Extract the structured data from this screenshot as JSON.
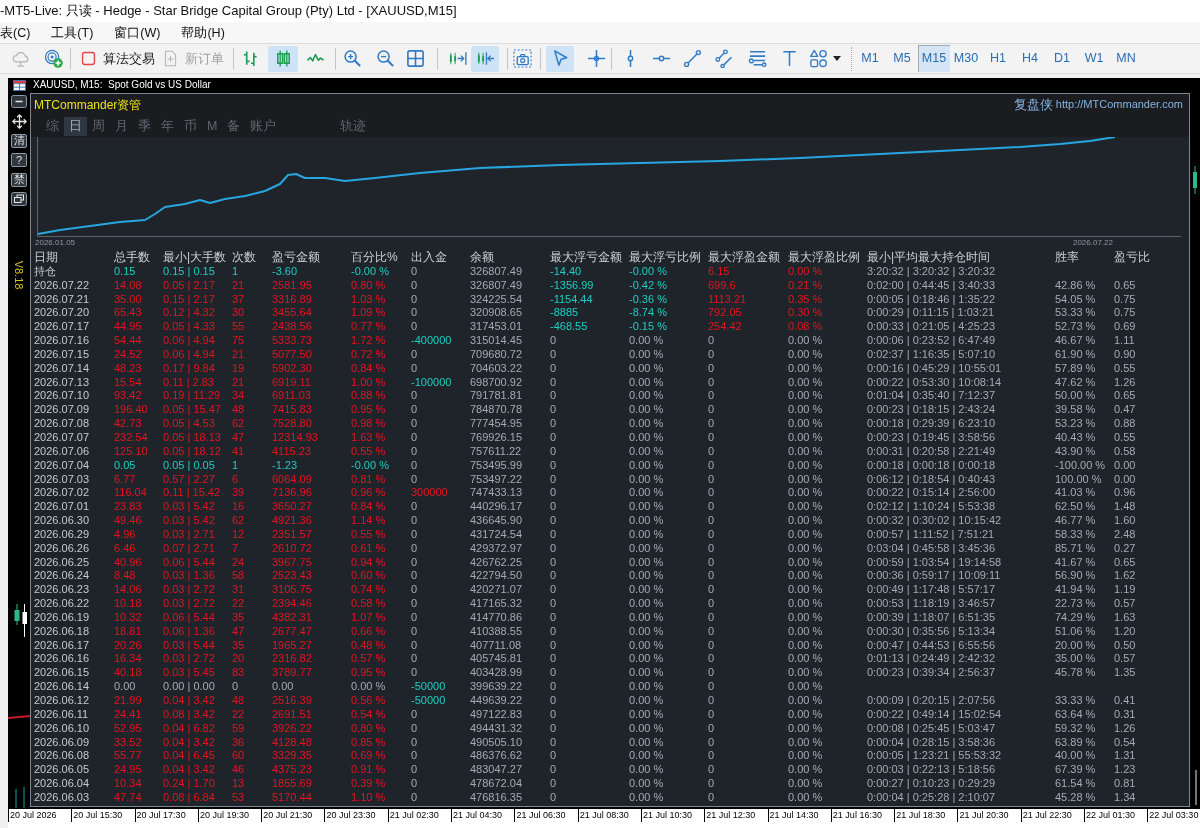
{
  "window": {
    "title": "-MT5-Live: 只读 - Hedge - Star Bridge Capital Group (Pty) Ltd - [XAUUSD,M15]"
  },
  "menu": [
    "表(C)",
    "工具(T)",
    "窗口(W)",
    "帮助(H)"
  ],
  "toolbar": {
    "services": [
      {
        "disabled": true
      },
      {
        "disabled": false
      }
    ],
    "buttons": [
      {
        "label": "算法交易",
        "disabled": false
      },
      {
        "label": "新订单",
        "disabled": true
      }
    ],
    "chart_modes": [
      {
        "selected": false
      },
      {
        "selected": true
      },
      {
        "selected": false
      }
    ],
    "chart_toggles": [
      {
        "on": false
      },
      {
        "on": true
      }
    ],
    "pointer_modes": [
      {
        "selected": true
      },
      {
        "selected": false
      }
    ],
    "timeframes": [
      {
        "label": "M1",
        "selected": false
      },
      {
        "label": "M5",
        "selected": false
      },
      {
        "label": "M15",
        "selected": true
      },
      {
        "label": "M30",
        "selected": false
      },
      {
        "label": "H1",
        "selected": false
      },
      {
        "label": "H4",
        "selected": false
      },
      {
        "label": "D1",
        "selected": false
      },
      {
        "label": "W1",
        "selected": false
      },
      {
        "label": "MN",
        "selected": false
      }
    ]
  },
  "chart": {
    "title": "XAUUSD, M15:  Spot Gold vs US Dollar",
    "side_buttons": [
      "清",
      "?",
      "禁"
    ],
    "version": "V8.18",
    "time_axis": [
      "20 Jul 2026",
      "20 Jul 15:30",
      "20 Jul 17:30",
      "20 Jul 19:30",
      "20 Jul 21:30",
      "20 Jul 23:30",
      "21 Jul 02:30",
      "21 Jul 04:30",
      "21 Jul 06:30",
      "21 Jul 08:30",
      "21 Jul 10:30",
      "21 Jul 12:30",
      "21 Jul 14:30",
      "21 Jul 16:30",
      "21 Jul 18:30",
      "21 Jul 20:30",
      "21 Jul 22:30",
      "22 Jul 01:30",
      "22 Jul 03:30"
    ]
  },
  "panel": {
    "title": "MTCommander资管",
    "brand": "复盘侠",
    "link": "http://MTCommander.com",
    "tabs": [
      {
        "label": "综",
        "selected": false
      },
      {
        "label": "日",
        "selected": true
      },
      {
        "label": "周",
        "selected": false
      },
      {
        "label": "月",
        "selected": false
      },
      {
        "label": "季",
        "selected": false
      },
      {
        "label": "年",
        "selected": false
      },
      {
        "label": "币",
        "selected": false
      },
      {
        "label": "M",
        "selected": false
      },
      {
        "label": "备",
        "selected": false
      },
      {
        "label": "账户",
        "selected": false
      }
    ],
    "extra_tabs": [
      {
        "label": "轨迹",
        "selected": false
      }
    ],
    "equity_curve": {
      "start_label": "2026.01.05",
      "end_label": "2026.07.22"
    },
    "table": {
      "columns": [
        "日期",
        "总手数",
        "最小|大手数",
        "次数",
        "盈亏金额",
        "百分比%",
        "出入金",
        "余额",
        "最大浮亏金额",
        "最大浮亏比例",
        "最大浮盈金额",
        "最大浮盈比例",
        "最小|平均最大持仓时间",
        "胜率",
        "盈亏比"
      ],
      "rows": [
        {
          "kind": "loss",
          "deposit": false,
          "withdrawal": false,
          "floating": true,
          "cells": [
            "持仓",
            "0.15",
            "0.15 | 0.15",
            "1",
            "-3.60",
            "-0.00 %",
            "0",
            "326807.49",
            "-14.40",
            "-0.00 %",
            "6.15",
            "0.00 %",
            "3:20:32 | 3:20:32 | 3:20:32"
          ]
        },
        {
          "kind": "gain",
          "deposit": false,
          "withdrawal": false,
          "floating": true,
          "cells": [
            "2026.07.22",
            "14.08",
            "0.05 | 2.17",
            "21",
            "2581.95",
            "0.80 %",
            "0",
            "326807.49",
            "-1356.99",
            "-0.42 %",
            "699.6",
            "0.21 %",
            "0:02:00 | 0:44:45 | 3:40:33",
            "42.86 %",
            "0.65"
          ]
        },
        {
          "kind": "gain",
          "deposit": false,
          "withdrawal": false,
          "floating": true,
          "cells": [
            "2026.07.21",
            "35.00",
            "0.15 | 2.17",
            "37",
            "3316.89",
            "1.03 %",
            "0",
            "324225.54",
            "-1154.44",
            "-0.36 %",
            "1113.21",
            "0.35 %",
            "0:00:05 | 0:18:46 | 1:35:22",
            "54.05 %",
            "0.75"
          ]
        },
        {
          "kind": "gain",
          "deposit": false,
          "withdrawal": false,
          "floating": true,
          "cells": [
            "2026.07.20",
            "65.43",
            "0.12 | 4.32",
            "30",
            "3455.64",
            "1.09 %",
            "0",
            "320908.65",
            "-8885",
            "-8.74 %",
            "792.05",
            "0.30 %",
            "0:00:29 | 0:11:15 | 1:03:21",
            "53.33 %",
            "0.75"
          ]
        },
        {
          "kind": "gain",
          "deposit": false,
          "withdrawal": false,
          "floating": true,
          "cells": [
            "2026.07.17",
            "44.95",
            "0.05 | 4.33",
            "55",
            "2438.56",
            "0.77 %",
            "0",
            "317453.01",
            "-468.55",
            "-0.15 %",
            "254.42",
            "0.08 %",
            "0:00:33 | 0:21:05 | 4:25:23",
            "52.73 %",
            "0.69"
          ]
        },
        {
          "kind": "gain",
          "deposit": false,
          "withdrawal": true,
          "floating": false,
          "cells": [
            "2026.07.16",
            "54.44",
            "0.06 | 4.94",
            "75",
            "5333.73",
            "1.72 %",
            "-400000",
            "315014.45",
            "0",
            "0.00 %",
            "0",
            "0.00 %",
            "0:00:06 | 0:23:52 | 6:47:49",
            "46.67 %",
            "1.11"
          ]
        },
        {
          "kind": "gain",
          "deposit": false,
          "withdrawal": false,
          "floating": false,
          "cells": [
            "2026.07.15",
            "24.52",
            "0.06 | 4.94",
            "21",
            "5077.50",
            "0.72 %",
            "0",
            "709680.72",
            "0",
            "0.00 %",
            "0",
            "0.00 %",
            "0:02:37 | 1:16:35 | 5:07:10",
            "61.90 %",
            "0.90"
          ]
        },
        {
          "kind": "gain",
          "deposit": false,
          "withdrawal": false,
          "floating": false,
          "cells": [
            "2026.07.14",
            "48.23",
            "0.17 | 9.84",
            "19",
            "5902.30",
            "0.84 %",
            "0",
            "704603.22",
            "0",
            "0.00 %",
            "0",
            "0.00 %",
            "0:00:16 | 0:45:29 | 10:55:01",
            "57.89 %",
            "0.55"
          ]
        },
        {
          "kind": "gain",
          "deposit": false,
          "withdrawal": true,
          "floating": false,
          "cells": [
            "2026.07.13",
            "15.54",
            "0.11 | 2.83",
            "21",
            "6919.11",
            "1.00 %",
            "-100000",
            "698700.92",
            "0",
            "0.00 %",
            "0",
            "0.00 %",
            "0:00:22 | 0:53:30 | 10:08:14",
            "47.62 %",
            "1.26"
          ]
        },
        {
          "kind": "gain",
          "deposit": false,
          "withdrawal": false,
          "floating": false,
          "cells": [
            "2026.07.10",
            "93.42",
            "0.19 | 11.29",
            "34",
            "6911.03",
            "0.88 %",
            "0",
            "791781.81",
            "0",
            "0.00 %",
            "0",
            "0.00 %",
            "0:01:04 | 0:35:40 | 7:12:37",
            "50.00 %",
            "0.65"
          ]
        },
        {
          "kind": "gain",
          "deposit": false,
          "withdrawal": false,
          "floating": false,
          "cells": [
            "2026.07.09",
            "196.40",
            "0.05 | 15.47",
            "48",
            "7415.83",
            "0.95 %",
            "0",
            "784870.78",
            "0",
            "0.00 %",
            "0",
            "0.00 %",
            "0:00:23 | 0:18:15 | 2:43:24",
            "39.58 %",
            "0.47"
          ]
        },
        {
          "kind": "gain",
          "deposit": false,
          "withdrawal": false,
          "floating": false,
          "cells": [
            "2026.07.08",
            "42.73",
            "0.05 | 4.53",
            "62",
            "7528.80",
            "0.98 %",
            "0",
            "777454.95",
            "0",
            "0.00 %",
            "0",
            "0.00 %",
            "0:00:18 | 0:29:39 | 6:23:10",
            "53.23 %",
            "0.88"
          ]
        },
        {
          "kind": "gain",
          "deposit": false,
          "withdrawal": false,
          "floating": false,
          "cells": [
            "2026.07.07",
            "232.54",
            "0.05 | 18.13",
            "47",
            "12314.93",
            "1.63 %",
            "0",
            "769926.15",
            "0",
            "0.00 %",
            "0",
            "0.00 %",
            "0:00:23 | 0:19:45 | 3:58:56",
            "40.43 %",
            "0.55"
          ]
        },
        {
          "kind": "gain",
          "deposit": false,
          "withdrawal": false,
          "floating": false,
          "cells": [
            "2026.07.06",
            "125.10",
            "0.05 | 18.12",
            "41",
            "4115.23",
            "0.55 %",
            "0",
            "757611.22",
            "0",
            "0.00 %",
            "0",
            "0.00 %",
            "0:00:31 | 0:20:58 | 2:21:49",
            "43.90 %",
            "0.58"
          ]
        },
        {
          "kind": "loss",
          "deposit": false,
          "withdrawal": false,
          "floating": false,
          "cells": [
            "2026.07.04",
            "0.05",
            "0.05 | 0.05",
            "1",
            "-1.23",
            "-0.00 %",
            "0",
            "753495.99",
            "0",
            "0.00 %",
            "0",
            "0.00 %",
            "0:00:18 | 0:00:18 | 0:00:18",
            "-100.00 %",
            "0.00"
          ]
        },
        {
          "kind": "gain",
          "deposit": false,
          "withdrawal": false,
          "floating": false,
          "cells": [
            "2026.07.03",
            "6.77",
            "0.57 | 2.27",
            "6",
            "6064.09",
            "0.81 %",
            "0",
            "753497.22",
            "0",
            "0.00 %",
            "0",
            "0.00 %",
            "0:06:12 | 0:18:54 | 0:40:43",
            "100.00 %",
            "0.00"
          ]
        },
        {
          "kind": "gain",
          "deposit": true,
          "withdrawal": false,
          "floating": false,
          "cells": [
            "2026.07.02",
            "116.04",
            "0.11 | 15.42",
            "39",
            "7136.96",
            "0.96 %",
            "300000",
            "747433.13",
            "0",
            "0.00 %",
            "0",
            "0.00 %",
            "0:00:22 | 0:15:14 | 2:56:00",
            "41.03 %",
            "0.96"
          ]
        },
        {
          "kind": "gain",
          "deposit": false,
          "withdrawal": false,
          "floating": false,
          "cells": [
            "2026.07.01",
            "23.83",
            "0.03 | 5.42",
            "16",
            "3650.27",
            "0.84 %",
            "0",
            "440296.17",
            "0",
            "0.00 %",
            "0",
            "0.00 %",
            "0:02:12 | 1:10:24 | 5:53:38",
            "62.50 %",
            "1.48"
          ]
        },
        {
          "kind": "gain",
          "deposit": false,
          "withdrawal": false,
          "floating": false,
          "cells": [
            "2026.06.30",
            "49.46",
            "0.03 | 5.42",
            "62",
            "4921.36",
            "1.14 %",
            "0",
            "436645.90",
            "0",
            "0.00 %",
            "0",
            "0.00 %",
            "0:00:32 | 0:30:02 | 10:15:42",
            "46.77 %",
            "1.60"
          ]
        },
        {
          "kind": "gain",
          "deposit": false,
          "withdrawal": false,
          "floating": false,
          "cells": [
            "2026.06.29",
            "4.96",
            "0.03 | 2.71",
            "12",
            "2351.57",
            "0.55 %",
            "0",
            "431724.54",
            "0",
            "0.00 %",
            "0",
            "0.00 %",
            "0:00:57 | 1:11:52 | 7:51:21",
            "58.33 %",
            "2.48"
          ]
        },
        {
          "kind": "gain",
          "deposit": false,
          "withdrawal": false,
          "floating": false,
          "cells": [
            "2026.06.26",
            "6.46",
            "0.07 | 2.71",
            "7",
            "2610.72",
            "0.61 %",
            "0",
            "429372.97",
            "0",
            "0.00 %",
            "0",
            "0.00 %",
            "0:03:04 | 0:45:58 | 3:45:36",
            "85.71 %",
            "0.27"
          ]
        },
        {
          "kind": "gain",
          "deposit": false,
          "withdrawal": false,
          "floating": false,
          "cells": [
            "2026.06.25",
            "40.96",
            "0.06 | 5.44",
            "24",
            "3967.75",
            "0.94 %",
            "0",
            "426762.25",
            "0",
            "0.00 %",
            "0",
            "0.00 %",
            "0:00:59 | 1:03:54 | 19:14:58",
            "41.67 %",
            "0.65"
          ]
        },
        {
          "kind": "gain",
          "deposit": false,
          "withdrawal": false,
          "floating": false,
          "cells": [
            "2026.06.24",
            "8.48",
            "0.03 | 1.36",
            "58",
            "2523.43",
            "0.60 %",
            "0",
            "422794.50",
            "0",
            "0.00 %",
            "0",
            "0.00 %",
            "0:00:36 | 0:59:17 | 10:09:11",
            "56.90 %",
            "1.62"
          ]
        },
        {
          "kind": "gain",
          "deposit": false,
          "withdrawal": false,
          "floating": false,
          "cells": [
            "2026.06.23",
            "14.06",
            "0.03 | 2.72",
            "31",
            "3105.75",
            "0.74 %",
            "0",
            "420271.07",
            "0",
            "0.00 %",
            "0",
            "0.00 %",
            "0:00:49 | 1:17:48 | 5:57:17",
            "41.94 %",
            "1.19"
          ]
        },
        {
          "kind": "gain",
          "deposit": false,
          "withdrawal": false,
          "floating": false,
          "cells": [
            "2026.06.22",
            "10.18",
            "0.03 | 2.72",
            "22",
            "2394.46",
            "0.58 %",
            "0",
            "417165.32",
            "0",
            "0.00 %",
            "0",
            "0.00 %",
            "0:00:53 | 1:18:19 | 3:46:57",
            "22.73 %",
            "0.57"
          ]
        },
        {
          "kind": "gain",
          "deposit": false,
          "withdrawal": false,
          "floating": false,
          "cells": [
            "2026.06.19",
            "10.32",
            "0.06 | 5.44",
            "35",
            "4382.31",
            "1.07 %",
            "0",
            "414770.86",
            "0",
            "0.00 %",
            "0",
            "0.00 %",
            "0:00:39 | 1:18:07 | 6:51:35",
            "74.29 %",
            "1.63"
          ]
        },
        {
          "kind": "gain",
          "deposit": false,
          "withdrawal": false,
          "floating": false,
          "cells": [
            "2026.06.18",
            "18.81",
            "0.06 | 1.36",
            "47",
            "2677.47",
            "0.66 %",
            "0",
            "410388.55",
            "0",
            "0.00 %",
            "0",
            "0.00 %",
            "0:00:30 | 0:35:56 | 5:13:34",
            "51.06 %",
            "1.20"
          ]
        },
        {
          "kind": "gain",
          "deposit": false,
          "withdrawal": false,
          "floating": false,
          "cells": [
            "2026.06.17",
            "20.26",
            "0.03 | 5.44",
            "35",
            "1965.27",
            "0.48 %",
            "0",
            "407711.08",
            "0",
            "0.00 %",
            "0",
            "0.00 %",
            "0:00:47 | 0:44:53 | 6:55:56",
            "20.00 %",
            "0.50"
          ]
        },
        {
          "kind": "gain",
          "deposit": false,
          "withdrawal": false,
          "floating": false,
          "cells": [
            "2026.06.16",
            "16.34",
            "0.03 | 2.72",
            "20",
            "2316.82",
            "0.57 %",
            "0",
            "405745.81",
            "0",
            "0.00 %",
            "0",
            "0.00 %",
            "0:01:13 | 0:24:49 | 2:42:32",
            "35.00 %",
            "0.57"
          ]
        },
        {
          "kind": "gain",
          "deposit": false,
          "withdrawal": false,
          "floating": false,
          "cells": [
            "2026.06.15",
            "40.18",
            "0.03 | 5.45",
            "83",
            "3789.77",
            "0.95 %",
            "0",
            "403428.99",
            "0",
            "0.00 %",
            "0",
            "0.00 %",
            "0:00:23 | 0:39:34 | 2:56:37",
            "45.78 %",
            "1.35"
          ]
        },
        {
          "kind": "flat",
          "deposit": false,
          "withdrawal": true,
          "floating": false,
          "cells": [
            "2026.06.14",
            "0.00",
            "0.00 | 0.00",
            "0",
            "0.00",
            "0.00 %",
            "-50000",
            "399639.22",
            "0",
            "0.00 %",
            "0",
            "0.00 %"
          ]
        },
        {
          "kind": "gain",
          "deposit": false,
          "withdrawal": true,
          "floating": false,
          "cells": [
            "2026.06.12",
            "21.99",
            "0.04 | 3.42",
            "48",
            "2516.39",
            "0.56 %",
            "-50000",
            "449639.22",
            "0",
            "0.00 %",
            "0",
            "0.00 %",
            "0:00:09 | 0:20:15 | 2:07:56",
            "33.33 %",
            "0.41"
          ]
        },
        {
          "kind": "gain",
          "deposit": false,
          "withdrawal": false,
          "floating": false,
          "cells": [
            "2026.06.11",
            "24.41",
            "0.08 | 3.42",
            "22",
            "2691.51",
            "0.54 %",
            "0",
            "497122.83",
            "0",
            "0.00 %",
            "0",
            "0.00 %",
            "0:00:22 | 0:49:14 | 15:02:54",
            "63.64 %",
            "0.31"
          ]
        },
        {
          "kind": "gain",
          "deposit": false,
          "withdrawal": false,
          "floating": false,
          "cells": [
            "2026.06.10",
            "52.95",
            "0.04 | 6.82",
            "59",
            "3926.22",
            "0.80 %",
            "0",
            "494431.32",
            "0",
            "0.00 %",
            "0",
            "0.00 %",
            "0:00:08 | 0:25:45 | 5:03:47",
            "59.32 %",
            "1.26"
          ]
        },
        {
          "kind": "gain",
          "deposit": false,
          "withdrawal": false,
          "floating": false,
          "cells": [
            "2026.06.09",
            "33.52",
            "0.04 | 3.42",
            "36",
            "4128.48",
            "0.85 %",
            "0",
            "490505.10",
            "0",
            "0.00 %",
            "0",
            "0.00 %",
            "0:00:04 | 0:28:15 | 3:58:36",
            "63.89 %",
            "0.54"
          ]
        },
        {
          "kind": "gain",
          "deposit": false,
          "withdrawal": false,
          "floating": false,
          "cells": [
            "2026.06.08",
            "55.77",
            "0.04 | 6.45",
            "60",
            "3329.35",
            "0.69 %",
            "0",
            "486376.62",
            "0",
            "0.00 %",
            "0",
            "0.00 %",
            "0:00:05 | 1:23:21 | 55:53:32",
            "40.00 %",
            "1.31"
          ]
        },
        {
          "kind": "gain",
          "deposit": false,
          "withdrawal": false,
          "floating": false,
          "cells": [
            "2026.06.05",
            "24.95",
            "0.04 | 3.42",
            "46",
            "4375.23",
            "0.91 %",
            "0",
            "483047.27",
            "0",
            "0.00 %",
            "0",
            "0.00 %",
            "0:00:03 | 0:22:13 | 5:18:56",
            "67.39 %",
            "1.23"
          ]
        },
        {
          "kind": "gain",
          "deposit": false,
          "withdrawal": false,
          "floating": false,
          "cells": [
            "2026.06.04",
            "10.34",
            "0.24 | 1.70",
            "13",
            "1855.69",
            "0.39 %",
            "0",
            "478672.04",
            "0",
            "0.00 %",
            "0",
            "0.00 %",
            "0:00:27 | 0:10:23 | 0:29:29",
            "61.54 %",
            "0.81"
          ]
        },
        {
          "kind": "gain",
          "deposit": false,
          "withdrawal": false,
          "floating": false,
          "cells": [
            "2026.06.03",
            "47.74",
            "0.08 | 6.84",
            "53",
            "5170.44",
            "1.10 %",
            "0",
            "476816.35",
            "0",
            "0.00 %",
            "0",
            "0.00 %",
            "0:00:04 | 0:25:28 | 2:10:07",
            "45.28 %",
            "1.34"
          ]
        }
      ]
    }
  }
}
